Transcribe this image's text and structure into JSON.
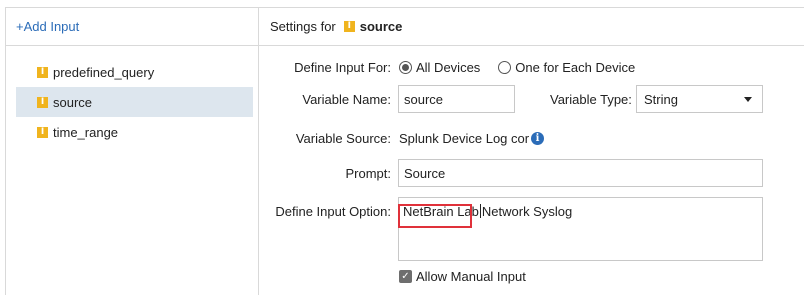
{
  "left": {
    "add_input_label": "+Add Input",
    "items": [
      {
        "badge": "I",
        "label": "predefined_query"
      },
      {
        "badge": "I",
        "label": "source"
      },
      {
        "badge": "I",
        "label": "time_range"
      }
    ]
  },
  "right": {
    "header": {
      "prefix": "Settings for",
      "badge": "I",
      "name": "source"
    },
    "define_input_for": {
      "label": "Define Input For:",
      "options": [
        {
          "label": "All Devices",
          "selected": true
        },
        {
          "label": "One for Each Device",
          "selected": false
        }
      ]
    },
    "variable_name": {
      "label": "Variable Name:",
      "value": "source"
    },
    "variable_type": {
      "label": "Variable Type:",
      "value": "String"
    },
    "variable_source": {
      "label": "Variable Source:",
      "value": "Splunk Device Log cor",
      "icon": "info-icon"
    },
    "prompt": {
      "label": "Prompt:",
      "value": "Source"
    },
    "define_input_option": {
      "label": "Define Input Option:",
      "text_before_cursor": "NetBrain Lab",
      "text_after_cursor": "Network Syslog"
    },
    "allow_manual_input": {
      "label": "Allow Manual Input",
      "checked": true
    }
  },
  "colors": {
    "accent_blue": "#2b6cb8",
    "badge_orange": "#f0b41e",
    "selected_row": "#dde6ee",
    "highlight_red": "#e0313a"
  }
}
